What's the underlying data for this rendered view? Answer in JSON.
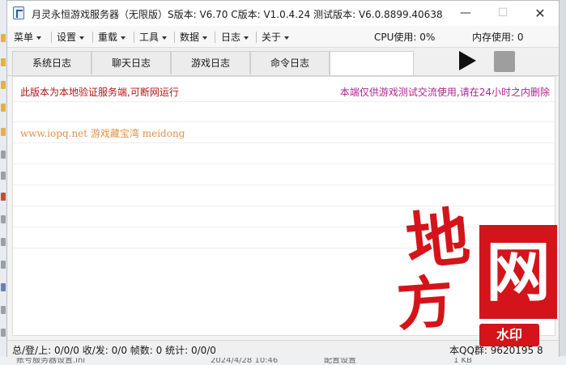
{
  "window": {
    "title": "月灵永恒游戏服务器（无限版）S版本: V6.70 C版本: V1.0.4.24 测试版本: V6.0.8899.40638",
    "min_glyph": "—",
    "max_glyph": "☐",
    "close_glyph": "✕"
  },
  "menu": {
    "items": [
      "菜单",
      "设置",
      "重载",
      "工具",
      "数据",
      "日志",
      "关于"
    ],
    "cpu": "CPU使用: 0%",
    "memory": "内存使用: 0"
  },
  "tabs": [
    "系统日志",
    "聊天日志",
    "游戏日志",
    "命令日志"
  ],
  "log": {
    "line1_left": "此版本为本地验证服务端,可断网运行",
    "line1_right": "本端仅供游戏测试交流使用,请在24小时之内删除",
    "line2": "www.iopq.net 游戏藏宝湾 meidong"
  },
  "status": {
    "text": "总/登/上: 0/0/0  收/发: 0/0  帧数: 0  统计: 0/0/0",
    "right": "本QQ群: 9620195 8"
  },
  "background": {
    "bottom_file": "账号服务器设置.ini",
    "bottom_date": "2024/4/28 10:46",
    "bottom_type": "配置设置",
    "bottom_size": "1 KB"
  },
  "watermark": {
    "di": "地",
    "fang": "方",
    "wang": "网",
    "seal": "水印"
  },
  "colors": {
    "notice_red": "#b01818",
    "notice_magenta": "#b0238f",
    "site_orange": "#e0914a",
    "watermark_red": "#d4141a"
  }
}
